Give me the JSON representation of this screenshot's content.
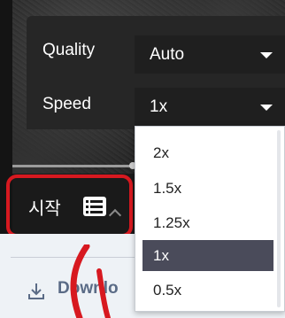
{
  "settings": {
    "quality": {
      "label": "Quality",
      "value": "Auto"
    },
    "speed": {
      "label": "Speed",
      "value": "1x"
    }
  },
  "speed_menu": {
    "options": [
      "2x",
      "1.5x",
      "1.25x",
      "1x",
      "0.5x"
    ],
    "selected": "1x"
  },
  "player": {
    "start_label": "시작",
    "list_icon": "list-icon",
    "collapse_icon": "chevron-up-icon"
  },
  "page": {
    "download_label": "Downlo",
    "download_icon": "download-icon"
  },
  "colors": {
    "highlight": "#d71920",
    "selected_bg": "#4a4b5a",
    "panel_bg": "#262626"
  }
}
